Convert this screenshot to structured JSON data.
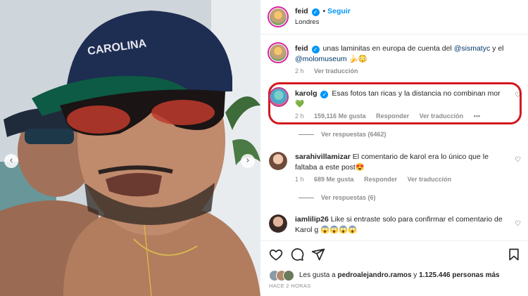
{
  "carousel": {
    "prev_glyph": "‹",
    "next_glyph": "›"
  },
  "post": {
    "username": "feid",
    "follow_label": "Seguir",
    "separator": "•",
    "location": "Londres"
  },
  "caption": {
    "username": "feid",
    "text_before": "unas laminitas en europa de cuenta del ",
    "mention1": "@sismatyc",
    "text_middle": " y el ",
    "mention2": "@molomuseum",
    "emojis": "🍌😳",
    "time": "2 h",
    "translate_label": "Ver traducción"
  },
  "comments": [
    {
      "username": "karolg",
      "verified": true,
      "text": "Esas fotos tan ricas y la distancia no combinan mor 💚",
      "time": "2 h",
      "likes": "159,116 Me gusta",
      "reply_label": "Responder",
      "translate_label": "Ver traducción",
      "more": "•••",
      "view_replies": "Ver respuestas (6462)",
      "highlight_color": "#d4181f"
    },
    {
      "username": "sarahivillamizar",
      "text": "El comentario de karol era lo único que le faltaba a este post😍",
      "time": "1 h",
      "likes": "689 Me gusta",
      "reply_label": "Responder",
      "translate_label": "Ver traducción",
      "view_replies": "Ver respuestas (6)"
    },
    {
      "username": "iamlilip26",
      "text": "Like si entraste solo para confirmar el comentario de Karol g 😱😱😱😱"
    }
  ],
  "likes_summary": {
    "prefix": "Les gusta a ",
    "user": "pedroalejandro.ramos",
    "middle": " y ",
    "count": "1.125.446 personas más"
  },
  "post_time": "HACE 2 HORAS",
  "icons": {
    "like": "heart-icon",
    "comment": "comment-icon",
    "share": "send-icon",
    "save": "bookmark-icon",
    "verified": "verified-badge-icon"
  },
  "colors": {
    "accent": "#0095f6",
    "highlight": "#d4181f",
    "link": "#00376b",
    "verified": "#0095f6"
  }
}
